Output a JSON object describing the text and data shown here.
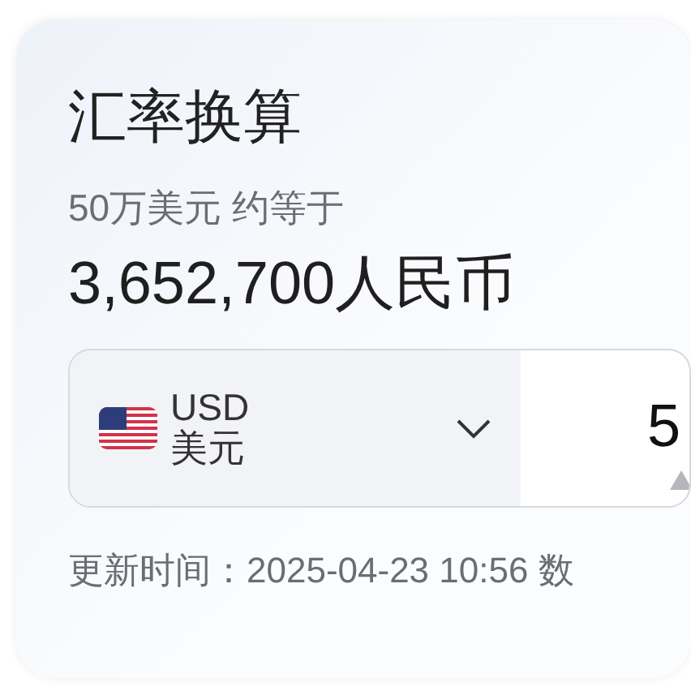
{
  "title": "汇率换算",
  "summary": "50万美元 约等于",
  "result": "3,652,700人民币",
  "converter": {
    "currency_code": "USD",
    "currency_name": "美元",
    "amount": "5"
  },
  "footer": "更新时间：2025-04-23 10:56 数"
}
